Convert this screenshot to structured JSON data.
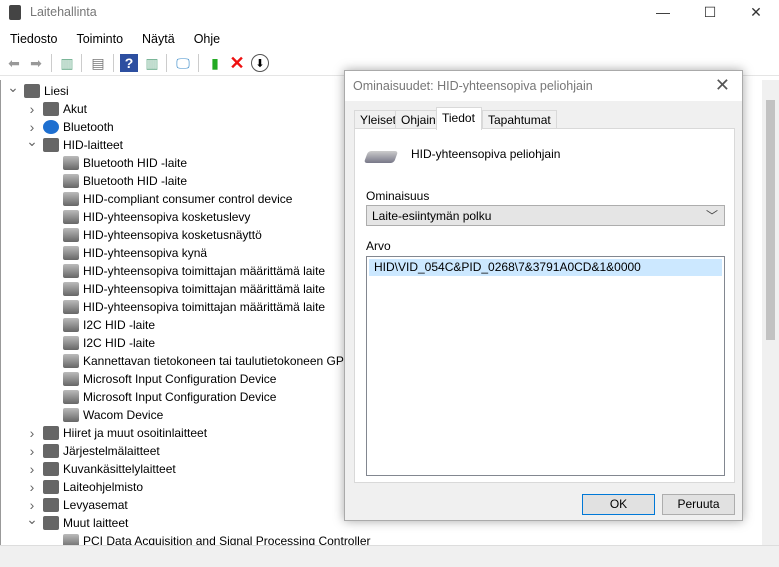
{
  "window": {
    "title": "Laitehallinta",
    "controls": [
      "—",
      "☐",
      "✕"
    ]
  },
  "menu": [
    "Tiedosto",
    "Toiminto",
    "Näytä",
    "Ohje"
  ],
  "toolbar": [
    "back-icon",
    "forward-icon",
    "show-hide-tree-icon",
    "properties-icon",
    "help-icon",
    "action-pane-icon",
    "scan-hardware-icon",
    "update-driver-icon",
    "uninstall-icon",
    "disable-device-icon"
  ],
  "tree": [
    {
      "label": "Liesi",
      "level": 0,
      "exp": "open"
    },
    {
      "label": "Akut",
      "level": 1,
      "exp": "closed"
    },
    {
      "label": "Bluetooth",
      "level": 1,
      "exp": "closed"
    },
    {
      "label": "HID-laitteet",
      "level": 1,
      "exp": "open"
    },
    {
      "label": "Bluetooth HID -laite",
      "level": 2
    },
    {
      "label": "Bluetooth HID -laite",
      "level": 2
    },
    {
      "label": "HID-compliant consumer control device",
      "level": 2
    },
    {
      "label": "HID-yhteensopiva kosketuslevy",
      "level": 2
    },
    {
      "label": "HID-yhteensopiva kosketusnäyttö",
      "level": 2
    },
    {
      "label": "HID-yhteensopiva kynä",
      "level": 2
    },
    {
      "label": "HID-yhteensopiva toimittajan määrittämä laite",
      "level": 2
    },
    {
      "label": "HID-yhteensopiva toimittajan määrittämä laite",
      "level": 2
    },
    {
      "label": "HID-yhteensopiva toimittajan määrittämä laite",
      "level": 2
    },
    {
      "label": "I2C HID -laite",
      "level": 2
    },
    {
      "label": "I2C HID -laite",
      "level": 2
    },
    {
      "label": "Kannettavan tietokoneen tai taulutietokoneen GPIO",
      "level": 2
    },
    {
      "label": "Microsoft Input Configuration Device",
      "level": 2
    },
    {
      "label": "Microsoft Input Configuration Device",
      "level": 2
    },
    {
      "label": "Wacom Device",
      "level": 2
    },
    {
      "label": "Hiiret ja muut osoitinlaitteet",
      "level": 1,
      "exp": "closed"
    },
    {
      "label": "Järjestelmälaitteet",
      "level": 1,
      "exp": "closed"
    },
    {
      "label": "Kuvankäsittelylaitteet",
      "level": 1,
      "exp": "closed"
    },
    {
      "label": "Laiteohjelmisto",
      "level": 1,
      "exp": "closed"
    },
    {
      "label": "Levyasemat",
      "level": 1,
      "exp": "closed"
    },
    {
      "label": "Muut laitteet",
      "level": 1,
      "exp": "open"
    },
    {
      "label": "PCI Data Acquisition and Signal Processing Controller",
      "level": 2
    }
  ],
  "dialog": {
    "title": "Ominaisuudet: HID-yhteensopiva peliohjain",
    "tabs": [
      "Yleiset",
      "Ohjain",
      "Tiedot",
      "Tapahtumat"
    ],
    "active_tab": "Tiedot",
    "device_name": "HID-yhteensopiva peliohjain",
    "property_label": "Ominaisuus",
    "property_value": "Laite-esiintymän polku",
    "value_label": "Arvo",
    "value": "HID\\VID_054C&PID_0268\\7&3791A0CD&1&0000",
    "ok": "OK",
    "cancel": "Peruuta"
  }
}
